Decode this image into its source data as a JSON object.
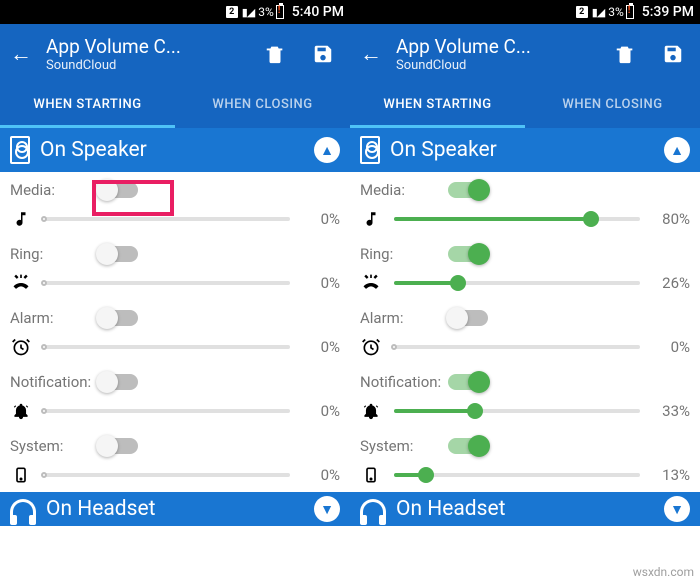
{
  "watermark": "wsxdn.com",
  "left": {
    "status": {
      "sim": "2",
      "battery_pct": "3%",
      "time": "5:40 PM"
    },
    "appbar": {
      "title": "App Volume C...",
      "subtitle": "SoundCloud"
    },
    "tabs": {
      "starting": "WHEN STARTING",
      "closing": "WHEN CLOSING"
    },
    "section_speaker": "On Speaker",
    "section_headset": "On Headset",
    "rows": [
      {
        "name": "Media:",
        "on": false,
        "pct": "0%"
      },
      {
        "name": "Ring:",
        "on": false,
        "pct": "0%"
      },
      {
        "name": "Alarm:",
        "on": false,
        "pct": "0%"
      },
      {
        "name": "Notification:",
        "on": false,
        "pct": "0%"
      },
      {
        "name": "System:",
        "on": false,
        "pct": "0%"
      }
    ]
  },
  "right": {
    "status": {
      "sim": "2",
      "battery_pct": "3%",
      "time": "5:39 PM"
    },
    "appbar": {
      "title": "App Volume C...",
      "subtitle": "SoundCloud"
    },
    "tabs": {
      "starting": "WHEN STARTING",
      "closing": "WHEN CLOSING"
    },
    "section_speaker": "On Speaker",
    "section_headset": "On Headset",
    "rows": [
      {
        "name": "Media:",
        "on": true,
        "pct": "80%",
        "p": 80
      },
      {
        "name": "Ring:",
        "on": true,
        "pct": "26%",
        "p": 26
      },
      {
        "name": "Alarm:",
        "on": false,
        "pct": "0%",
        "p": 0
      },
      {
        "name": "Notification:",
        "on": true,
        "pct": "33%",
        "p": 33
      },
      {
        "name": "System:",
        "on": true,
        "pct": "13%",
        "p": 13
      }
    ]
  },
  "icons": [
    "music-note-icon",
    "ring-volume-icon",
    "alarm-clock-icon",
    "bell-icon",
    "phone-icon"
  ]
}
